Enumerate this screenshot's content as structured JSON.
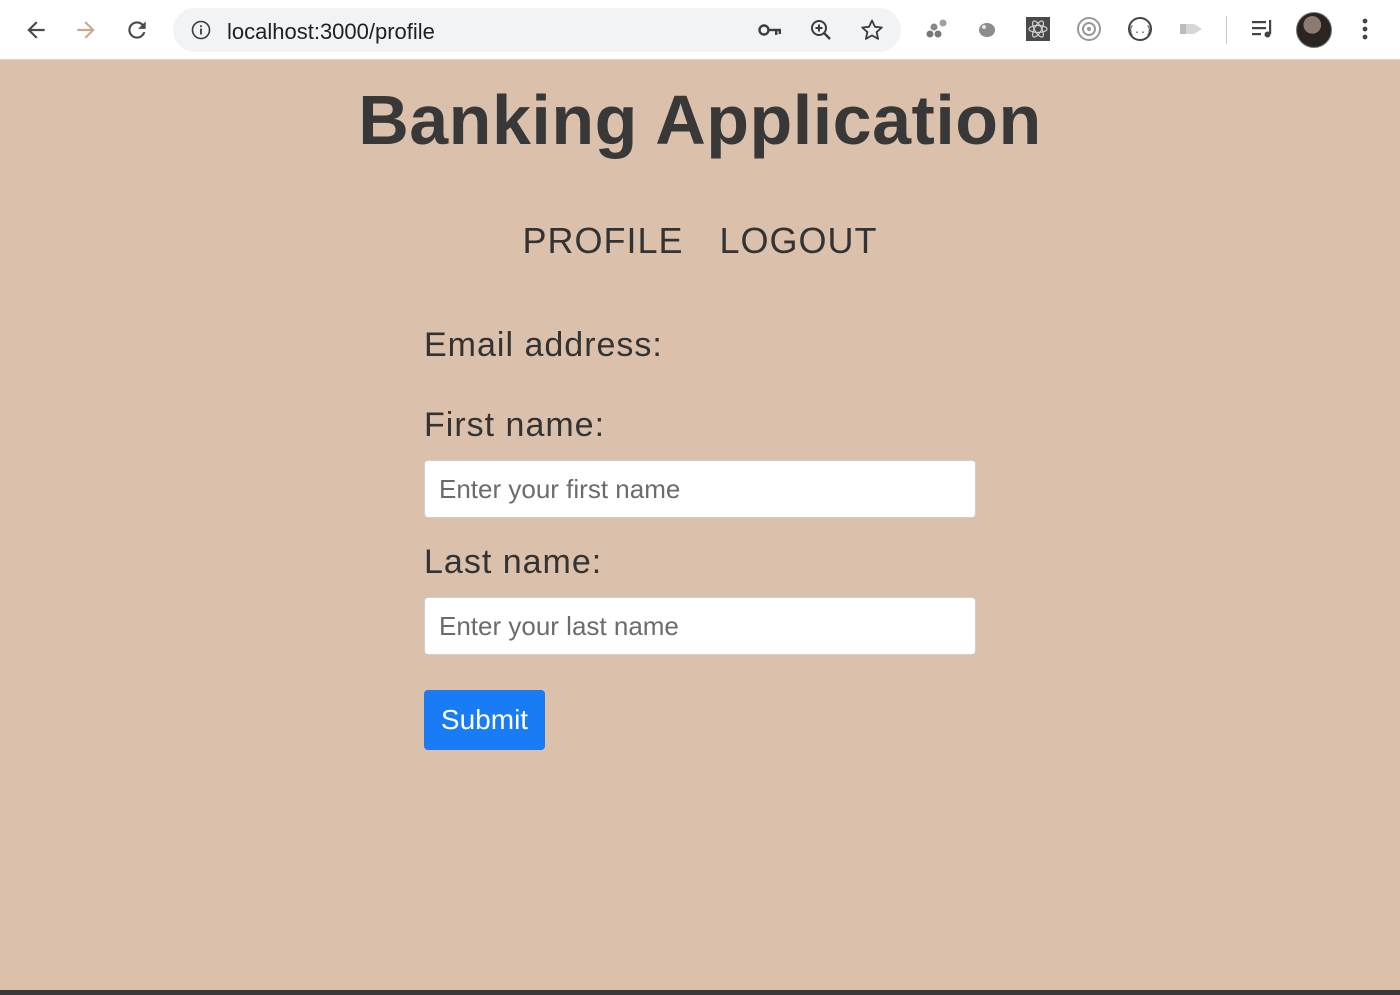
{
  "browser": {
    "url": "localhost:3000/profile",
    "back_icon": "back-arrow-icon",
    "forward_icon": "forward-arrow-icon",
    "reload_icon": "reload-icon",
    "omnibox_icons": [
      "key-icon",
      "zoom-icon",
      "star-icon"
    ],
    "extensions": [
      "extension-icon",
      "extension-icon",
      "extension-icon",
      "extension-icon",
      "extension-icon",
      "extension-icon"
    ],
    "menu_icon": "more-vert-icon"
  },
  "page": {
    "title": "Banking Application",
    "nav": {
      "profile": "PROFILE",
      "logout": "LOGOUT"
    },
    "form": {
      "email_label": "Email address:",
      "first_name_label": "First name:",
      "first_name_placeholder": "Enter your first name",
      "first_name_value": "",
      "last_name_label": "Last name:",
      "last_name_placeholder": "Enter your last name",
      "last_name_value": "",
      "submit_label": "Submit"
    }
  },
  "colors": {
    "page_background": "#dbc1ac",
    "submit_button": "#1a7cf5",
    "text": "#333333"
  }
}
